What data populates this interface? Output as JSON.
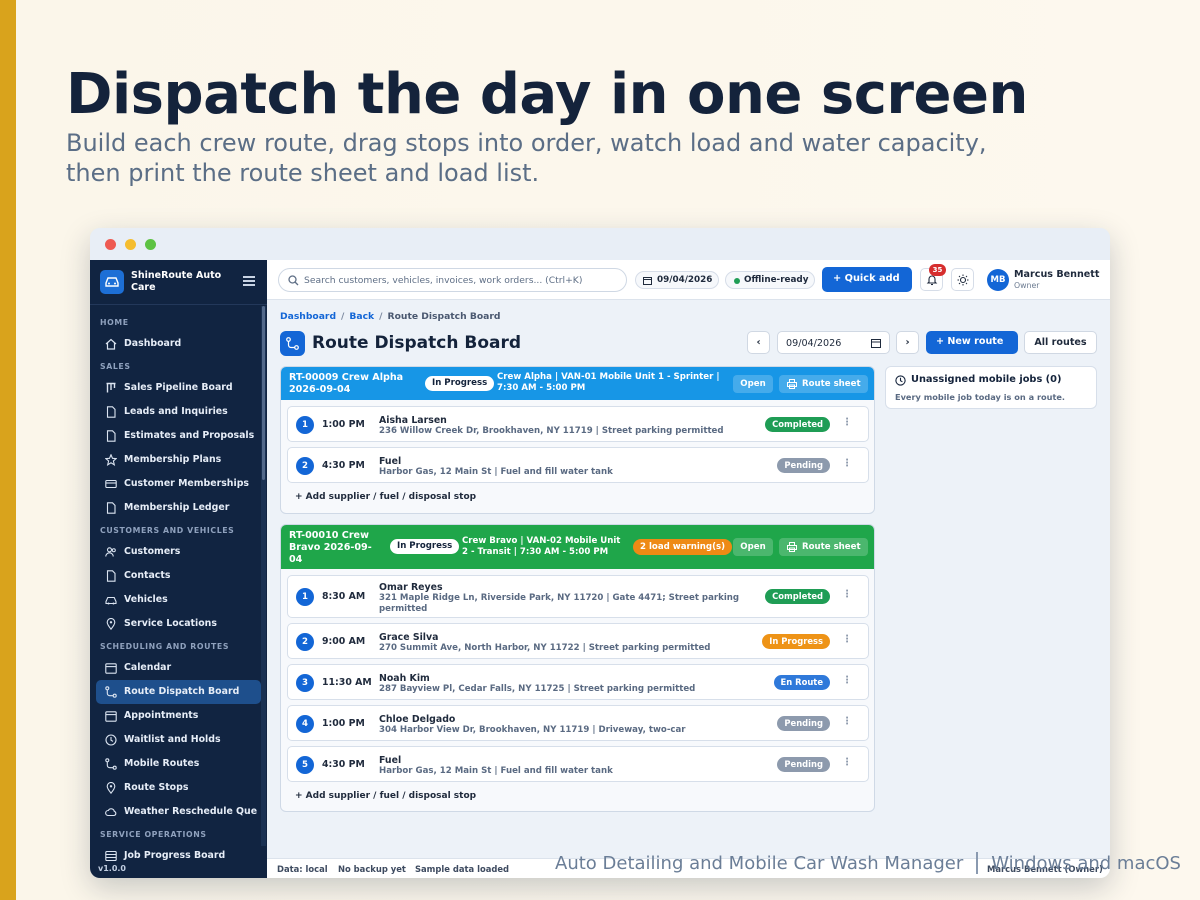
{
  "hero": {
    "title": "Dispatch the day in one screen",
    "subtitle": "Build each crew route, drag stops into order, watch load and water capacity, then print the route sheet and load list."
  },
  "app": {
    "brand": "ShineRoute Auto Care",
    "version": "v1.0.0"
  },
  "sidebar": {
    "sections": [
      {
        "title": "HOME",
        "items": [
          {
            "label": "Dashboard",
            "icon": "home-icon"
          }
        ]
      },
      {
        "title": "SALES",
        "items": [
          {
            "label": "Sales Pipeline Board",
            "icon": "board-icon"
          },
          {
            "label": "Leads and Inquiries",
            "icon": "document-icon"
          },
          {
            "label": "Estimates and Proposals",
            "icon": "document-icon"
          },
          {
            "label": "Membership Plans",
            "icon": "star-icon"
          },
          {
            "label": "Customer Memberships",
            "icon": "card-icon"
          },
          {
            "label": "Membership Ledger",
            "icon": "document-icon"
          }
        ]
      },
      {
        "title": "CUSTOMERS AND VEHICLES",
        "items": [
          {
            "label": "Customers",
            "icon": "users-icon"
          },
          {
            "label": "Contacts",
            "icon": "document-icon"
          },
          {
            "label": "Vehicles",
            "icon": "car-icon"
          },
          {
            "label": "Service Locations",
            "icon": "pin-icon"
          }
        ]
      },
      {
        "title": "SCHEDULING AND ROUTES",
        "items": [
          {
            "label": "Calendar",
            "icon": "calendar-icon"
          },
          {
            "label": "Route Dispatch Board",
            "icon": "route-icon",
            "active": true
          },
          {
            "label": "Appointments",
            "icon": "calendar-icon"
          },
          {
            "label": "Waitlist and Holds",
            "icon": "clock-icon"
          },
          {
            "label": "Mobile Routes",
            "icon": "route-icon"
          },
          {
            "label": "Route Stops",
            "icon": "pin-icon"
          },
          {
            "label": "Weather Reschedule Que",
            "icon": "cloud-icon"
          }
        ]
      },
      {
        "title": "SERVICE OPERATIONS",
        "items": [
          {
            "label": "Job Progress Board",
            "icon": "stack-icon"
          }
        ]
      }
    ]
  },
  "topbar": {
    "search_placeholder": "Search customers, vehicles, invoices, work orders...  (Ctrl+K)",
    "date": "09/04/2026",
    "offline": "Offline-ready",
    "quick_add": "+ Quick add",
    "notification_count": "35",
    "user_initials": "MB",
    "user_name": "Marcus Bennett",
    "user_role": "Owner"
  },
  "page": {
    "breadcrumb": {
      "home": "Dashboard",
      "back": "Back",
      "current": "Route Dispatch Board"
    },
    "title": "Route Dispatch Board",
    "date_value": "09/04/2026",
    "prev": "‹",
    "next": "›",
    "new_route": "+ New route",
    "all_routes": "All routes"
  },
  "routes": [
    {
      "id": "RT-00009 Crew Alpha 2026-09-04",
      "status": "In Progress",
      "info": "Crew Alpha | VAN-01 Mobile Unit 1 - Sprinter | 7:30 AM - 5:00 PM",
      "warning": "",
      "open": "Open",
      "sheet": "Route sheet",
      "stops": [
        {
          "num": "1",
          "time": "1:00 PM",
          "name": "Aisha Larsen",
          "addr": "236 Willow Creek Dr, Brookhaven, NY 11719 | Street parking permitted",
          "status": "Completed"
        },
        {
          "num": "2",
          "time": "4:30 PM",
          "name": "Fuel",
          "addr": "Harbor Gas, 12 Main St | Fuel and fill water tank",
          "status": "Pending"
        }
      ],
      "add": "+ Add supplier / fuel / disposal stop"
    },
    {
      "id": "RT-00010 Crew Bravo 2026-09-04",
      "status": "In Progress",
      "info": "Crew Bravo | VAN-02 Mobile Unit 2 - Transit | 7:30 AM - 5:00 PM",
      "warning": "2 load warning(s)",
      "open": "Open",
      "sheet": "Route sheet",
      "stops": [
        {
          "num": "1",
          "time": "8:30 AM",
          "name": "Omar Reyes",
          "addr": "321 Maple Ridge Ln, Riverside Park, NY 11720 | Gate 4471; Street parking permitted",
          "status": "Completed"
        },
        {
          "num": "2",
          "time": "9:00 AM",
          "name": "Grace Silva",
          "addr": "270 Summit Ave, North Harbor, NY 11722 | Street parking permitted",
          "status": "In Progress"
        },
        {
          "num": "3",
          "time": "11:30 AM",
          "name": "Noah Kim",
          "addr": "287 Bayview Pl, Cedar Falls, NY 11725 | Street parking permitted",
          "status": "En Route"
        },
        {
          "num": "4",
          "time": "1:00 PM",
          "name": "Chloe Delgado",
          "addr": "304 Harbor View Dr, Brookhaven, NY 11719 | Driveway, two-car",
          "status": "Pending"
        },
        {
          "num": "5",
          "time": "4:30 PM",
          "name": "Fuel",
          "addr": "Harbor Gas, 12 Main St | Fuel and fill water tank",
          "status": "Pending"
        }
      ],
      "add": "+ Add supplier / fuel / disposal stop"
    }
  ],
  "unassigned": {
    "title": "Unassigned mobile jobs (0)",
    "subtitle": "Every mobile job today is on a route."
  },
  "statusbar": {
    "data": "Data: local",
    "backup": "No backup yet",
    "sample": "Sample data loaded",
    "user": "Marcus Bennett (Owner)"
  },
  "footer": {
    "product": "Auto Detailing and Mobile Car Wash Manager",
    "platforms": "Windows and macOS"
  },
  "colors": {
    "accent": "#1366d6",
    "sidebar": "#112441",
    "route_alpha": "#1796e6",
    "route_bravo": "#1fa64a",
    "gold": "#d9a31c"
  }
}
